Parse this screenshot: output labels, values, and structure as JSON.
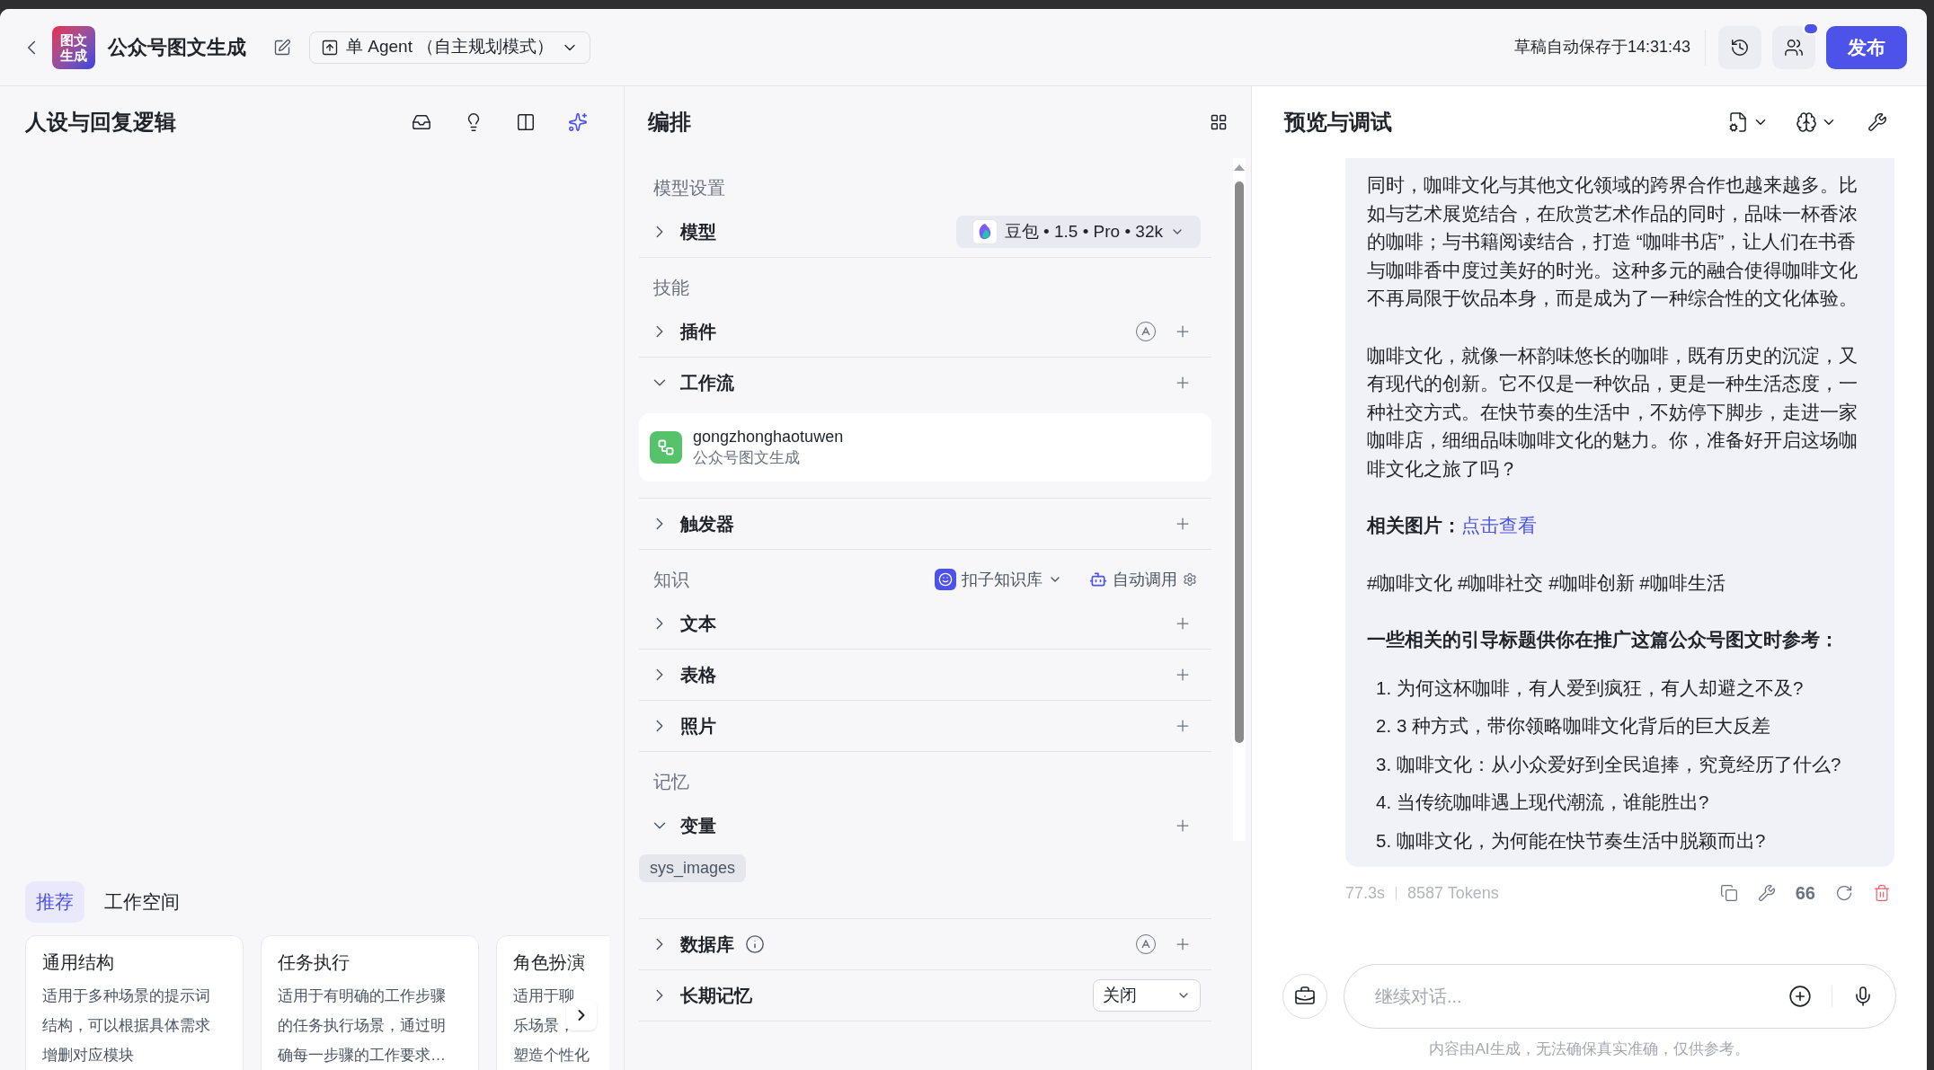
{
  "header": {
    "logo": [
      "图文",
      "生成"
    ],
    "title": "公众号图文生成",
    "mode": "单 Agent （自主规划模式）",
    "autosave": "草稿自动保存于14:31:43",
    "publish": "发布",
    "collab_badge": true
  },
  "left": {
    "title": "人设与回复逻辑",
    "tabs": [
      {
        "label": "推荐",
        "selected": true
      },
      {
        "label": "工作空间",
        "selected": false
      }
    ],
    "cards": [
      {
        "title": "通用结构",
        "lines": [
          "适用于多种场景的提示词",
          "结构，可以根据具体需求",
          "增删对应模块"
        ]
      },
      {
        "title": "任务执行",
        "lines": [
          "适用于有明确的工作步骤",
          "的任务执行场景，通过明",
          "确每一步骤的工作要求…"
        ]
      },
      {
        "title": "角色扮演",
        "lines": [
          "适用于聊",
          "乐场景，",
          "塑造个性化"
        ]
      }
    ]
  },
  "middle": {
    "title": "编排",
    "sections": [
      {
        "label": "模型设置",
        "rows": [
          {
            "label": "模型",
            "expanded": false,
            "model": "豆包 • 1.5 • Pro • 32k"
          }
        ]
      },
      {
        "label": "技能",
        "rows": [
          {
            "label": "插件",
            "expanded": false,
            "auto": true,
            "add": true
          },
          {
            "label": "工作流",
            "expanded": true,
            "add": true,
            "items": [
              {
                "name": "gongzhonghaotuwen",
                "subtitle": "公众号图文生成"
              }
            ]
          },
          {
            "label": "触发器",
            "expanded": false,
            "add": true
          }
        ]
      },
      {
        "label": "知识",
        "source": "扣子知识库",
        "call": "自动调用",
        "rows": [
          {
            "label": "文本",
            "expanded": false,
            "add": true
          },
          {
            "label": "表格",
            "expanded": false,
            "add": true
          },
          {
            "label": "照片",
            "expanded": false,
            "add": true
          }
        ]
      },
      {
        "label": "记忆",
        "rows": [
          {
            "label": "变量",
            "expanded": true,
            "add": true,
            "tags": [
              "sys_images"
            ]
          },
          {
            "label": "数据库",
            "expanded": false,
            "info": true,
            "auto": true,
            "add": true
          },
          {
            "label": "长期记忆",
            "expanded": false,
            "select": "关闭"
          }
        ]
      }
    ]
  },
  "right": {
    "title": "预览与调试",
    "message": [
      {
        "kind": "paragraph",
        "text": "同时，咖啡文化与其他文化领域的跨界合作也越来越多。比如与艺术展览结合，在欣赏艺术作品的同时，品味一杯香浓的咖啡；与书籍阅读结合，打造 “咖啡书店”，让人们在书香与咖啡香中度过美好的时光。这种多元的融合使得咖啡文化不再局限于饮品本身，而是成为了一种综合性的文化体验。"
      },
      {
        "kind": "paragraph",
        "text": "咖啡文化，就像一杯韵味悠长的咖啡，既有历史的沉淀，又有现代的创新。它不仅是一种饮品，更是一种生活态度，一种社交方式。在快节奏的生活中，不妨停下脚步，走进一家咖啡店，细细品味咖啡文化的魅力。你，准备好开启这场咖啡文化之旅了吗？"
      },
      {
        "kind": "link_line",
        "label": "相关图片：",
        "link": "点击查看"
      },
      {
        "kind": "paragraph",
        "text": "#咖啡文化 #咖啡社交 #咖啡创新 #咖啡生活"
      },
      {
        "kind": "heading",
        "text": "一些相关的引导标题供你在推广这篇公众号图文时参考："
      },
      {
        "kind": "list",
        "items": [
          {
            "num": "1.",
            "text": "为何这杯咖啡，有人爱到疯狂，有人却避之不及?"
          },
          {
            "num": "2.",
            "text": "3 种方式，带你领略咖啡文化背后的巨大反差"
          },
          {
            "num": "3.",
            "text": "咖啡文化：从小众爱好到全民追捧，究竟经历了什么?"
          },
          {
            "num": "4.",
            "text": "当传统咖啡遇上现代潮流，谁能胜出?"
          },
          {
            "num": "5.",
            "text": "咖啡文化，为何能在快节奏生活中脱颖而出?"
          }
        ]
      }
    ],
    "duration": "77.3s",
    "tokens": "8587 Tokens",
    "quote_label": "66",
    "placeholder": "继续对话...",
    "disclaimer": "内容由AI生成，无法确保真实准确，仅供参考。"
  }
}
